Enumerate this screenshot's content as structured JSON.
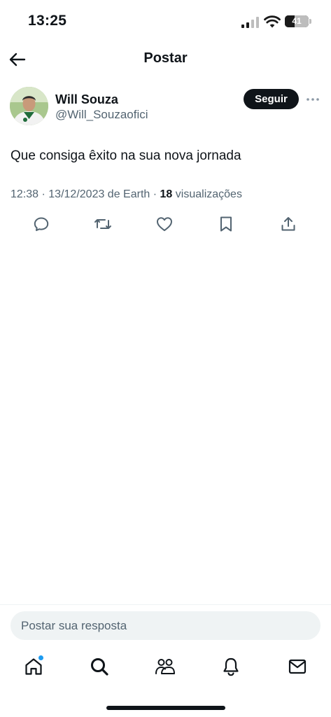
{
  "status_bar": {
    "time": "13:25",
    "battery_level": "41",
    "battery_percent": 41
  },
  "header": {
    "title": "Postar",
    "back_icon": "arrow-left-icon"
  },
  "post": {
    "author_name": "Will Souza",
    "author_handle": "@Will_Souzaofici",
    "follow_label": "Seguir",
    "more_icon": "more-horizontal-icon",
    "text": "Que consiga êxito na sua nova jornada",
    "time": "12:38",
    "separator": "·",
    "date": "13/12/2023 de Earth",
    "views_count": "18",
    "views_label": "visualizações",
    "actions": [
      {
        "icon": "reply-icon"
      },
      {
        "icon": "repost-icon"
      },
      {
        "icon": "like-icon"
      },
      {
        "icon": "bookmark-icon"
      },
      {
        "icon": "share-icon"
      }
    ]
  },
  "reply": {
    "placeholder": "Postar sua resposta"
  },
  "tab_bar": {
    "items": [
      {
        "icon": "home-icon",
        "has_notification_dot": true
      },
      {
        "icon": "search-icon"
      },
      {
        "icon": "communities-icon"
      },
      {
        "icon": "notifications-icon"
      },
      {
        "icon": "messages-icon"
      }
    ]
  },
  "colors": {
    "text": "#0f1419",
    "secondary_text": "#536471",
    "accent": "#1d9bf0",
    "input_background": "#eff3f4",
    "button_background": "#0f1419"
  }
}
